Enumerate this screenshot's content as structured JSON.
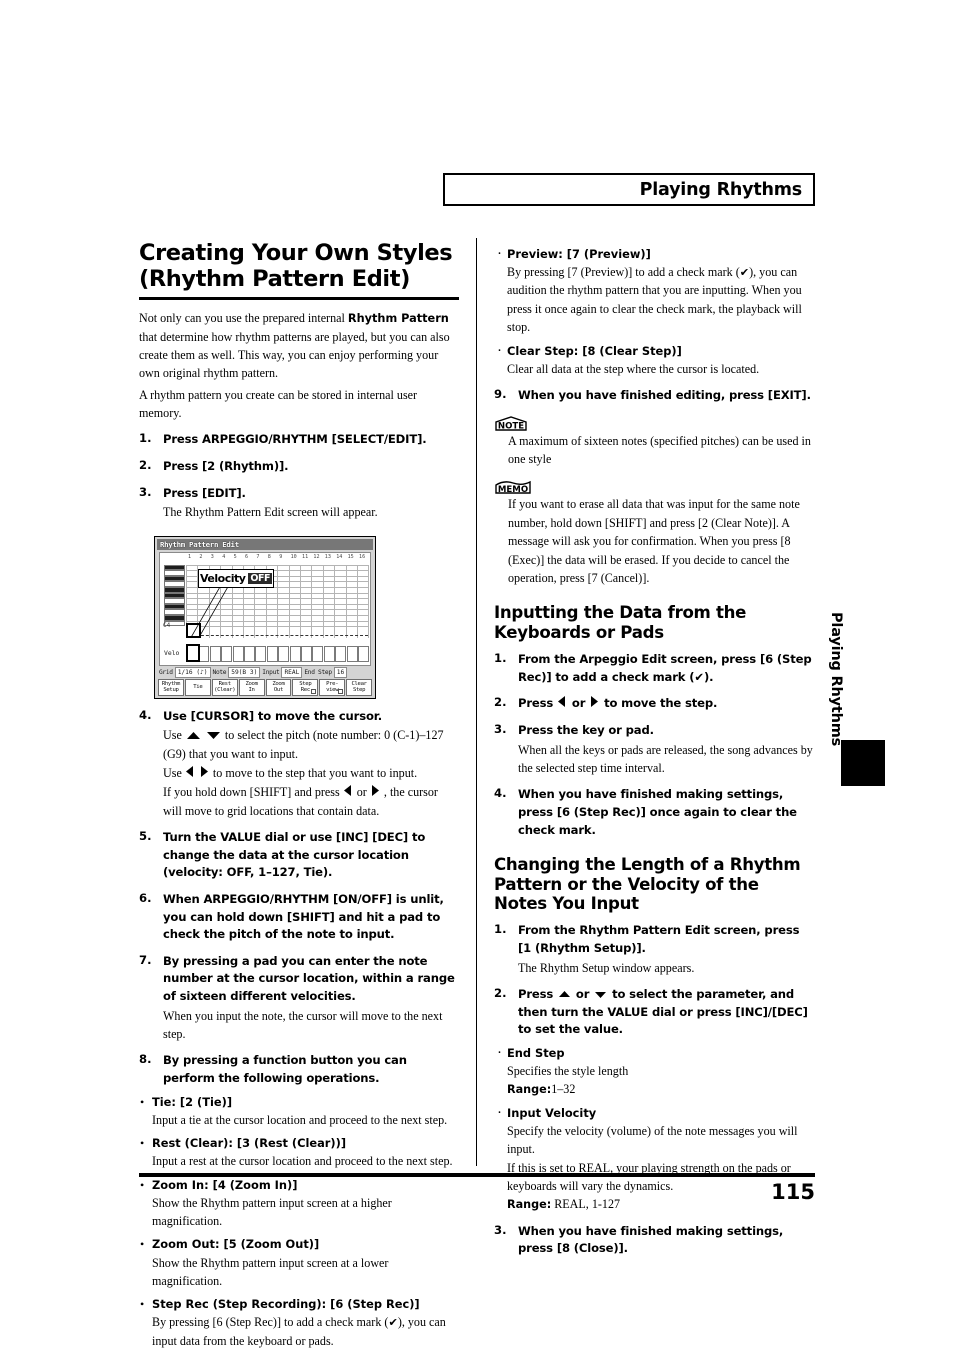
{
  "header": {
    "running_head": "Playing Rhythms"
  },
  "footer": {
    "page_number": "115"
  },
  "side_tab": {
    "label": "Playing Rhythms"
  },
  "left_column": {
    "title_line1": "Creating Your Own Styles",
    "title_line2": "(Rhythm Pattern Edit)",
    "intro_1_a": "Not only can you use the prepared internal ",
    "intro_1_bold": "Rhythm Pattern",
    "intro_1_b": " that determine how rhythm patterns are played, but you can also create them as well. This way, you can enjoy performing your own original rhythm pattern.",
    "intro_2": "A rhythm pattern you create can be stored in internal user memory.",
    "steps": [
      {
        "num": "1.",
        "lead": "Press ARPEGGIO/RHYTHM [SELECT/EDIT]."
      },
      {
        "num": "2.",
        "lead": "Press [2 (Rhythm)]."
      },
      {
        "num": "3.",
        "lead": "Press [EDIT].",
        "sub": "The Rhythm Pattern Edit screen will appear."
      },
      {
        "num": "4.",
        "lead": "Use [CURSOR] to move the cursor."
      },
      {
        "num": "5.",
        "lead": "Turn the VALUE dial or use [INC] [DEC] to change the data at the cursor location (velocity: OFF, 1–127, Tie)."
      },
      {
        "num": "6.",
        "lead": "When ARPEGGIO/RHYTHM [ON/OFF] is unlit, you can hold down [SHIFT] and hit a pad to check the pitch of the note to input."
      },
      {
        "num": "7.",
        "lead": "By pressing a pad you can enter the note number at the cursor location, within a range of sixteen different velocities.",
        "sub": "When you input the note, the cursor will move to the next step."
      },
      {
        "num": "8.",
        "lead": "By pressing a function button you can perform the following operations."
      }
    ],
    "step4_lines": {
      "l1_a": "Use",
      "l1_b": "to select the pitch (note number: 0 (C-1)–127 (G9) that you want to input.",
      "l2_a": "Use",
      "l2_b": "to move to the step that you want to input.",
      "l3_a": "If you hold down [SHIFT] and press",
      "l3_or": "or",
      "l3_b": ", the cursor will move to grid locations that contain data."
    },
    "function_bullets": [
      {
        "lead": "Tie: [2 (Tie)]",
        "sub": "Input a tie at the cursor location and proceed to the next step."
      },
      {
        "lead": "Rest (Clear): [3 (Rest (Clear))]",
        "sub": "Input a rest at the cursor location and proceed to the next step."
      },
      {
        "lead": "Zoom In: [4 (Zoom In)]",
        "sub": "Show the Rhythm pattern input screen at a higher magnification."
      },
      {
        "lead": "Zoom Out: [5 (Zoom Out)]",
        "sub": "Show the Rhythm pattern input screen at a lower magnification."
      },
      {
        "lead": "Step Rec (Step Recording): [6 (Step Rec)]",
        "sub_a": "By pressing [6 (Step Rec)] to add a check mark (",
        "sub_check": "✔",
        "sub_b": "), you can input data from the keyboard or pads."
      }
    ]
  },
  "lcd": {
    "title": "Rhythm Pattern Edit",
    "callout_label": "Velocity",
    "callout_value": "OFF",
    "axis_label": "C4",
    "velo_label": "Velo",
    "top_left_label": "--/#",
    "column_numbers": [
      "1",
      "2",
      "3",
      "4",
      "5",
      "6",
      "7",
      "8",
      "9",
      "10",
      "11",
      "12",
      "13",
      "14",
      "15",
      "16"
    ],
    "status": [
      {
        "label": "Grid",
        "value": "1/16 (♪)"
      },
      {
        "label": "Note",
        "value": "59(B 3)"
      },
      {
        "label": "Input",
        "value": "REAL"
      },
      {
        "label": "End Step",
        "value": "16"
      }
    ],
    "function_keys": [
      {
        "line1": "Rhythm",
        "line2": "Setup",
        "check": false
      },
      {
        "line1": "Tie",
        "line2": "",
        "check": false
      },
      {
        "line1": "Rest",
        "line2": "(Clear)",
        "check": false
      },
      {
        "line1": "Zoom",
        "line2": "In",
        "check": false
      },
      {
        "line1": "Zoom",
        "line2": "Out",
        "check": false
      },
      {
        "line1": "Step",
        "line2": "Rec",
        "check": true
      },
      {
        "line1": "Pre-",
        "line2": "view",
        "check": true
      },
      {
        "line1": "Clear",
        "line2": "Step",
        "check": false
      }
    ]
  },
  "right_column": {
    "preview_bullet": {
      "lead": "Preview: [7 (Preview)]",
      "sub_a": "By pressing [7 (Preview)] to add a check mark (",
      "sub_check": "✔",
      "sub_b": "), you can audition the rhythm pattern that you are inputting. When you press it once again to clear the check mark, the playback will stop."
    },
    "clear_step_bullet": {
      "lead": "Clear Step: [8 (Clear Step)]",
      "sub": "Clear all data at the step where the cursor is located."
    },
    "step9": {
      "num": "9.",
      "lead": "When you have finished editing, press [EXIT]."
    },
    "note": {
      "badge": "NOTE",
      "text": "A maximum of sixteen notes (specified pitches) can be used in one style"
    },
    "memo": {
      "badge": "MEMO",
      "text": "If you want to erase all data that was input for the same note number, hold down [SHIFT] and press [2 (Clear Note)]. A message will ask you for confirmation. When you press [8 (Exec)] the data will be erased. If you decide to cancel the operation, press [7 (Cancel)]."
    },
    "section_inputting": {
      "title_line1": "Inputting the Data from the Keyboards",
      "title_line2": "or Pads",
      "steps": [
        {
          "num": "1.",
          "lead_a": "From the Arpeggio Edit screen, press [6 (Step Rec)] to add a check mark (",
          "lead_check": "✔",
          "lead_b": ")."
        },
        {
          "num": "2.",
          "lead_a": "Press",
          "lead_or": "or",
          "lead_b": "to move the step."
        },
        {
          "num": "3.",
          "lead": "Press the key or pad.",
          "sub": "When all the keys or pads are released, the song advances by the selected step time interval."
        },
        {
          "num": "4.",
          "lead": "When you have finished making settings, press [6 (Step Rec)] once again to clear the check mark."
        }
      ]
    },
    "section_changing": {
      "title_line1": "Changing the Length of a Rhythm",
      "title_line2": "Pattern or the Velocity of the Notes",
      "title_line3": "You Input",
      "step1": {
        "num": "1.",
        "lead": "From the Rhythm Pattern Edit screen, press [1 (Rhythm Setup)].",
        "sub": "The Rhythm Setup window appears."
      },
      "step2": {
        "num": "2.",
        "lead_a": "Press",
        "lead_or": "or",
        "lead_b": "to select the parameter, and then turn the VALUE dial or press [INC]/[DEC] to set the value."
      },
      "params": [
        {
          "lead": "End Step",
          "sub": "Specifies the style length",
          "range_label": "Range:",
          "range_value": "1–32"
        },
        {
          "lead": "Input Velocity",
          "sub": "Specify the velocity (volume) of the note messages you will input.",
          "sub2": "If this is set to REAL, your playing strength on the pads or keyboards will vary the dynamics.",
          "range_label": "Range:",
          "range_value": " REAL, 1-127"
        }
      ],
      "step3": {
        "num": "3.",
        "lead": "When you have finished making settings, press [8 (Close)]."
      }
    }
  }
}
